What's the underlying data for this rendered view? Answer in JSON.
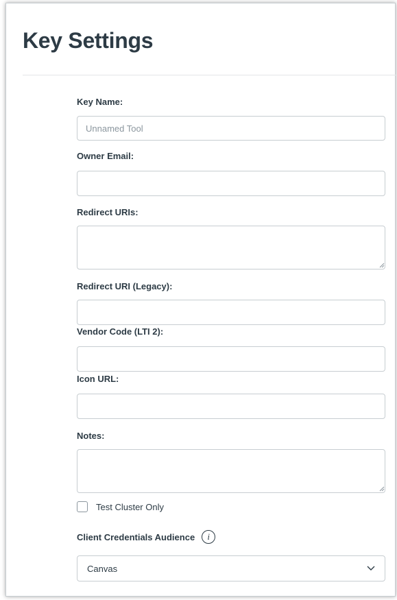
{
  "page": {
    "title": "Key Settings"
  },
  "form": {
    "key_name": {
      "label": "Key Name:",
      "placeholder": "Unnamed Tool",
      "value": ""
    },
    "owner_email": {
      "label": "Owner Email:",
      "value": ""
    },
    "redirect_uris": {
      "label": "Redirect URIs:",
      "value": ""
    },
    "redirect_uri_legacy": {
      "label": "Redirect URI (Legacy):",
      "value": ""
    },
    "vendor_code": {
      "label": "Vendor Code (LTI 2):",
      "value": ""
    },
    "icon_url": {
      "label": "Icon URL:",
      "value": ""
    },
    "notes": {
      "label": "Notes:",
      "value": ""
    },
    "test_cluster_only": {
      "label": "Test Cluster Only",
      "checked": false
    },
    "client_credentials_audience": {
      "label": "Client Credentials Audience",
      "selected": "Canvas",
      "info_icon": "info-icon"
    }
  }
}
